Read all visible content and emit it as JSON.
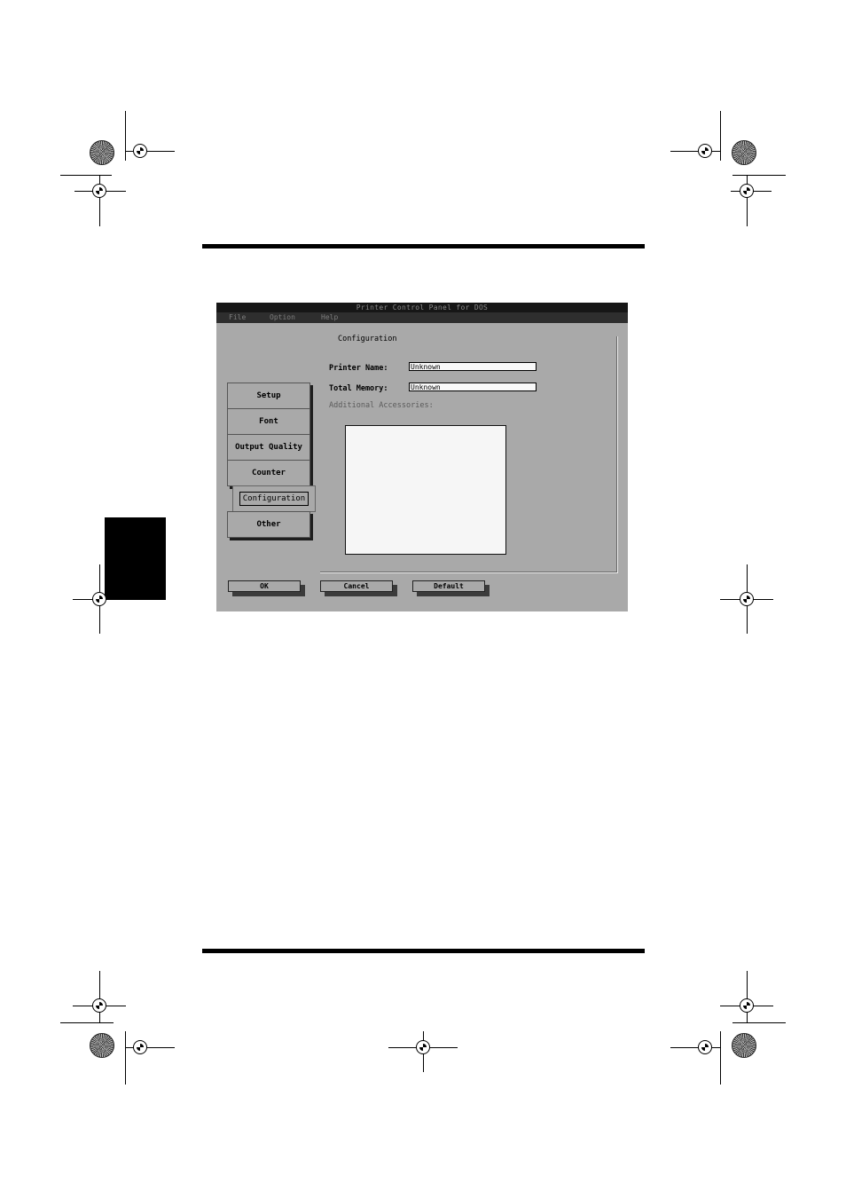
{
  "window": {
    "title": "Printer Control Panel for DOS"
  },
  "menu": [
    "File",
    "Option",
    "Help"
  ],
  "tabs": [
    {
      "label": "Setup"
    },
    {
      "label": "Font"
    },
    {
      "label": "Output Quality"
    },
    {
      "label": "Counter"
    },
    {
      "label": "Configuration"
    },
    {
      "label": "Other"
    }
  ],
  "panel": {
    "title": "Configuration",
    "printer_name_label": "Printer Name:",
    "printer_name_value": "Unknown",
    "total_memory_label": "Total Memory:",
    "total_memory_value": "Unknown",
    "accessories_label": "Additional Accessories:"
  },
  "buttons": {
    "ok": "OK",
    "cancel": "Cancel",
    "default": "Default"
  },
  "colors": {
    "window_bg": "#a9a9a9",
    "titlebar_bg": "#161616"
  }
}
